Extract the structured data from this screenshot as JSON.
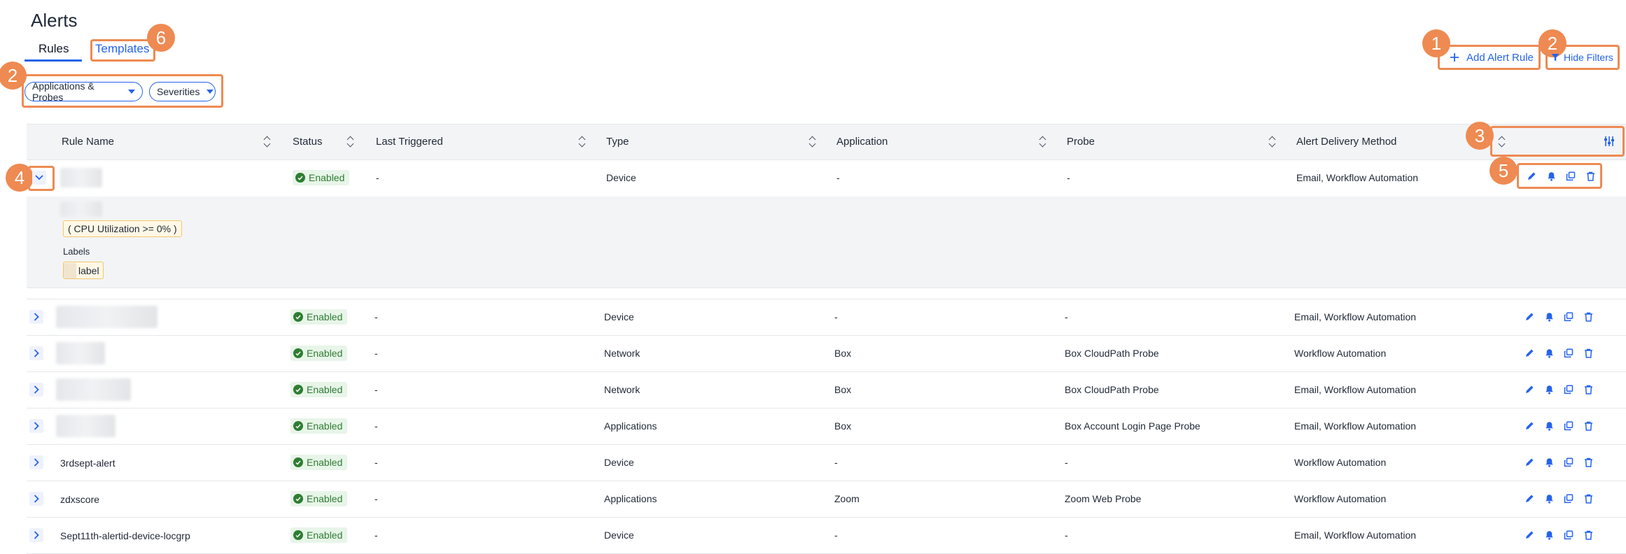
{
  "page": {
    "title": "Alerts"
  },
  "tabs": [
    {
      "label": "Rules"
    },
    {
      "label": "Templates"
    }
  ],
  "toolbar": {
    "add_alert_rule": "Add Alert Rule",
    "hide_filters": "Hide Filters"
  },
  "filters": [
    {
      "label": "Applications & Probes"
    },
    {
      "label": "Severities"
    }
  ],
  "callouts": [
    "1",
    "2",
    "2",
    "3",
    "4",
    "5",
    "6"
  ],
  "table": {
    "columns": [
      "Rule Name",
      "Status",
      "Last Triggered",
      "Type",
      "Application",
      "Probe",
      "Alert Delivery Method"
    ],
    "expanded": {
      "condition": "( CPU Utilization >= 0% )",
      "labels_heading": "Labels",
      "label_chip": "label"
    },
    "rows": [
      {
        "name": "",
        "status": "Enabled",
        "last_triggered": "-",
        "type": "Device",
        "application": "-",
        "probe": "-",
        "delivery": "Email, Workflow Automation"
      },
      {
        "name": "",
        "status": "Enabled",
        "last_triggered": "-",
        "type": "Device",
        "application": "-",
        "probe": "-",
        "delivery": "Email, Workflow Automation"
      },
      {
        "name": "",
        "status": "Enabled",
        "last_triggered": "-",
        "type": "Network",
        "application": "Box",
        "probe": "Box CloudPath Probe",
        "delivery": "Workflow Automation"
      },
      {
        "name": "",
        "status": "Enabled",
        "last_triggered": "-",
        "type": "Network",
        "application": "Box",
        "probe": "Box CloudPath Probe",
        "delivery": "Email, Workflow Automation"
      },
      {
        "name": "",
        "status": "Enabled",
        "last_triggered": "-",
        "type": "Applications",
        "application": "Box",
        "probe": "Box Account Login Page Probe",
        "delivery": "Email, Workflow Automation"
      },
      {
        "name": "3rdsept-alert",
        "status": "Enabled",
        "last_triggered": "-",
        "type": "Device",
        "application": "-",
        "probe": "-",
        "delivery": "Workflow Automation"
      },
      {
        "name": "zdxscore",
        "status": "Enabled",
        "last_triggered": "-",
        "type": "Applications",
        "application": "Zoom",
        "probe": "Zoom Web Probe",
        "delivery": "Workflow Automation"
      },
      {
        "name": "Sept11th-alertid-device-locgrp",
        "status": "Enabled",
        "last_triggered": "-",
        "type": "Device",
        "application": "-",
        "probe": "-",
        "delivery": "Email, Workflow Automation"
      }
    ]
  },
  "colors": {
    "accent": "#2563eb",
    "callout": "#ee8a52",
    "enabled": "#2e7d32"
  },
  "icons": [
    "plus-icon",
    "filter-icon",
    "column-settings-icon",
    "chevron-down-icon",
    "chevron-right-icon",
    "edit-icon",
    "bell-icon",
    "copy-icon",
    "trash-icon",
    "check-icon"
  ]
}
